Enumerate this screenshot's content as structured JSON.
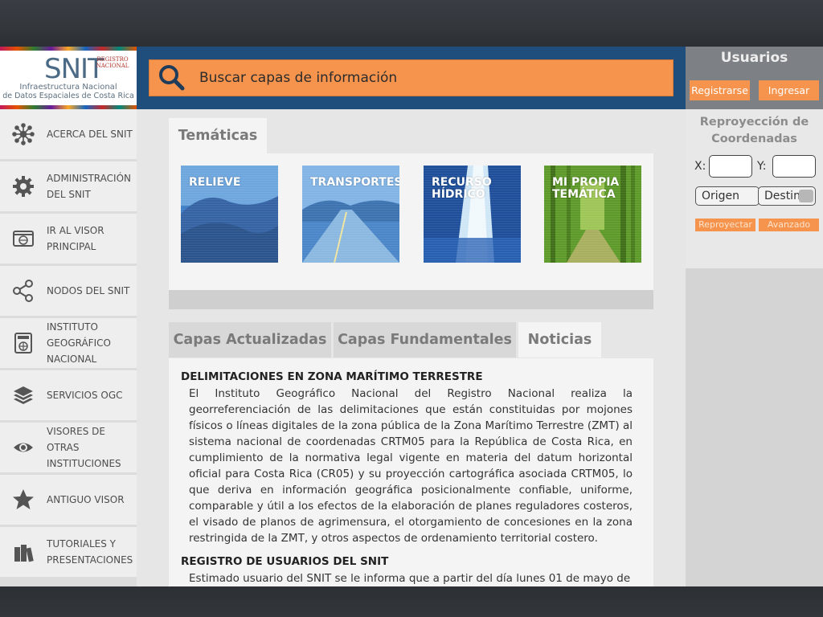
{
  "logo": {
    "snit": "SNIT",
    "registro": "REGISTRO NACIONAL",
    "line1": "Infraestructura Nacional",
    "line2": "de Datos Espaciales de Costa Rica"
  },
  "search": {
    "placeholder": "Buscar capas de información"
  },
  "users": {
    "title": "Usuarios",
    "register": "Registrarse",
    "login": "Ingresar"
  },
  "reprojection": {
    "title": "Reproyección de Coordenadas",
    "x_label": "X:",
    "y_label": "Y:",
    "origin": "Origen",
    "destination": "Destino",
    "reproject": "Reproyectar",
    "advanced": "Avanzado"
  },
  "sidebar": {
    "items": [
      {
        "label": "ACERCA DEL SNIT",
        "icon": "network-icon"
      },
      {
        "label": "ADMINISTRACIÓN\nDEL SNIT",
        "icon": "gear-icon"
      },
      {
        "label": "IR AL VISOR\nPRINCIPAL",
        "icon": "map-window-icon"
      },
      {
        "label": "NODOS DEL SNIT",
        "icon": "share-icon"
      },
      {
        "label": "INSTITUTO\nGEOGRÁFICO\nNACIONAL",
        "icon": "globe-building-icon"
      },
      {
        "label": "SERVICIOS OGC",
        "icon": "layers-icon"
      },
      {
        "label": "VISORES DE OTRAS\nINSTITUCIONES",
        "icon": "eye-icon"
      },
      {
        "label": "ANTIGUO VISOR",
        "icon": "star-icon"
      },
      {
        "label": "TUTORIALES Y\nPRESENTACIONES",
        "icon": "books-icon"
      }
    ]
  },
  "tematicas": {
    "tab": "Temáticas",
    "tiles": [
      "RELIEVE",
      "TRANSPORTES",
      "RECURSO\nHÍDRICO",
      "MI PROPIA\nTEMÁTICA"
    ]
  },
  "news_tabs": [
    "Capas Actualizadas",
    "Capas Fundamentales",
    "Noticias"
  ],
  "news": [
    {
      "title": "DELIMITACIONES EN ZONA MARÍTIMO TERRESTRE",
      "body": "El Instituto Geográfico Nacional del Registro Nacional realiza la georreferenciación de las delimitaciones que están constituidas por mojones físicos o líneas digitales de la zona pública de la Zona Marítimo Terrestre (ZMT) al sistema nacional de coordenadas CRTM05 para la República de Costa Rica, en cumplimiento de la normativa legal vigente en materia del datum horizontal oficial para Costa Rica (CR05) y su proyección cartográfica asociada CRTM05, lo que deriva en información geográfica posicionalmente confiable, uniforme, comparable y útil a los efectos de la elaboración de planes reguladores costeros, el visado de planos de agrimensura, el otorgamiento de concesiones en la zona restringida de la ZMT, y otros aspectos de ordenamiento territorial costero."
    },
    {
      "title": "REGISTRO DE USUARIOS DEL SNIT",
      "body": "Estimado usuario del SNIT se le informa que a partir del día lunes 01 de mayo de"
    }
  ],
  "colors": {
    "header": "#1f4e7d",
    "accent": "#f6944e",
    "users_bg": "#7d8084"
  }
}
